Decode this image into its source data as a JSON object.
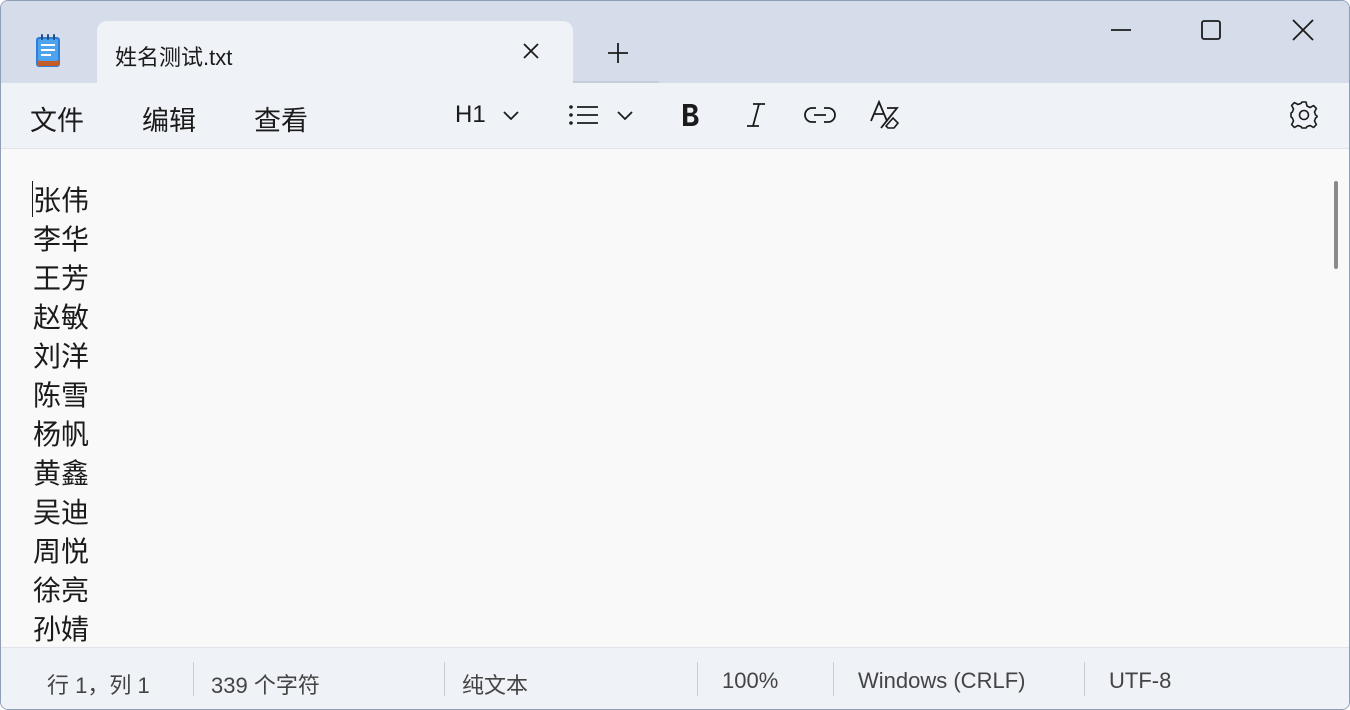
{
  "window": {
    "tab_title": "姓名测试.txt"
  },
  "menu": {
    "items": [
      "文件",
      "编辑",
      "查看"
    ]
  },
  "toolbar": {
    "heading_label": "H1",
    "icons": [
      "list-icon",
      "bold-icon",
      "italic-icon",
      "link-icon",
      "clear-formatting-icon",
      "settings-icon"
    ]
  },
  "document": {
    "lines": [
      "张伟",
      "李华",
      "王芳",
      "赵敏",
      "刘洋",
      "陈雪",
      "杨帆",
      "黄鑫",
      "吴迪",
      "周悦",
      "徐亮",
      "孙婧"
    ]
  },
  "statusbar": {
    "position": "行 1，列 1",
    "char_count": "339 个字符",
    "format": "纯文本",
    "zoom": "100%",
    "line_ending": "Windows (CRLF)",
    "encoding": "UTF-8"
  },
  "colors": {
    "titlebar_bg": "#d5ddea",
    "toolbar_bg": "#eff2f7",
    "editor_bg": "#f9f9f9",
    "text": "#1b1b1b"
  }
}
